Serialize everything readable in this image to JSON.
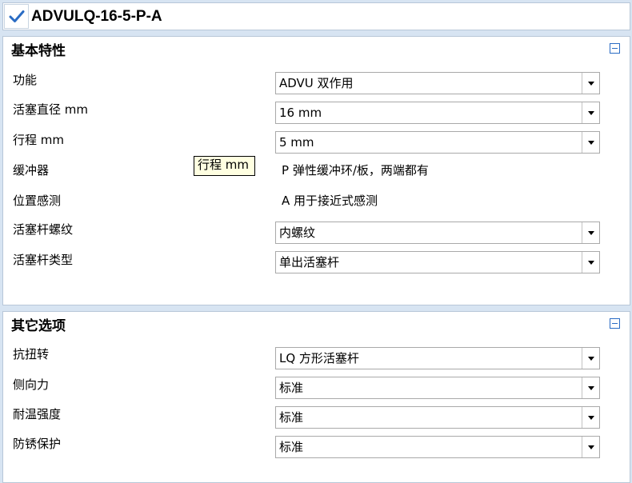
{
  "header": {
    "checked": true,
    "model_code": "ADVULQ-16-5-P-A"
  },
  "basic": {
    "title": "基本特性",
    "rows": [
      {
        "label": "功能",
        "type": "select",
        "value": "ADVU 双作用"
      },
      {
        "label": "活塞直径 mm",
        "type": "select",
        "value": "16 mm"
      },
      {
        "label": "行程 mm",
        "type": "select",
        "value": "5 mm"
      },
      {
        "label": "缓冲器",
        "type": "static",
        "value": "P 弹性缓冲环/板，两端都有"
      },
      {
        "label": "位置感测",
        "type": "static",
        "value": "A 用于接近式感测"
      },
      {
        "label": "活塞杆螺纹",
        "type": "select",
        "value": "内螺纹"
      },
      {
        "label": "活塞杆类型",
        "type": "select",
        "value": "单出活塞杆"
      }
    ]
  },
  "tooltip": {
    "text": "行程 mm"
  },
  "other": {
    "title": "其它选项",
    "rows": [
      {
        "label": "抗扭转",
        "type": "select",
        "value": "LQ 方形活塞杆"
      },
      {
        "label": "侧向力",
        "type": "select",
        "value": "标准"
      },
      {
        "label": "耐温强度",
        "type": "select",
        "value": "标准"
      },
      {
        "label": "防锈保护",
        "type": "select",
        "value": "标准"
      }
    ]
  },
  "colors": {
    "background": "#d7e4f2",
    "accent": "#2a6cc4",
    "tooltip_bg": "#ffffe1"
  },
  "icons": [
    "checkmark-icon",
    "collapse-icon",
    "dropdown-arrow-icon"
  ]
}
